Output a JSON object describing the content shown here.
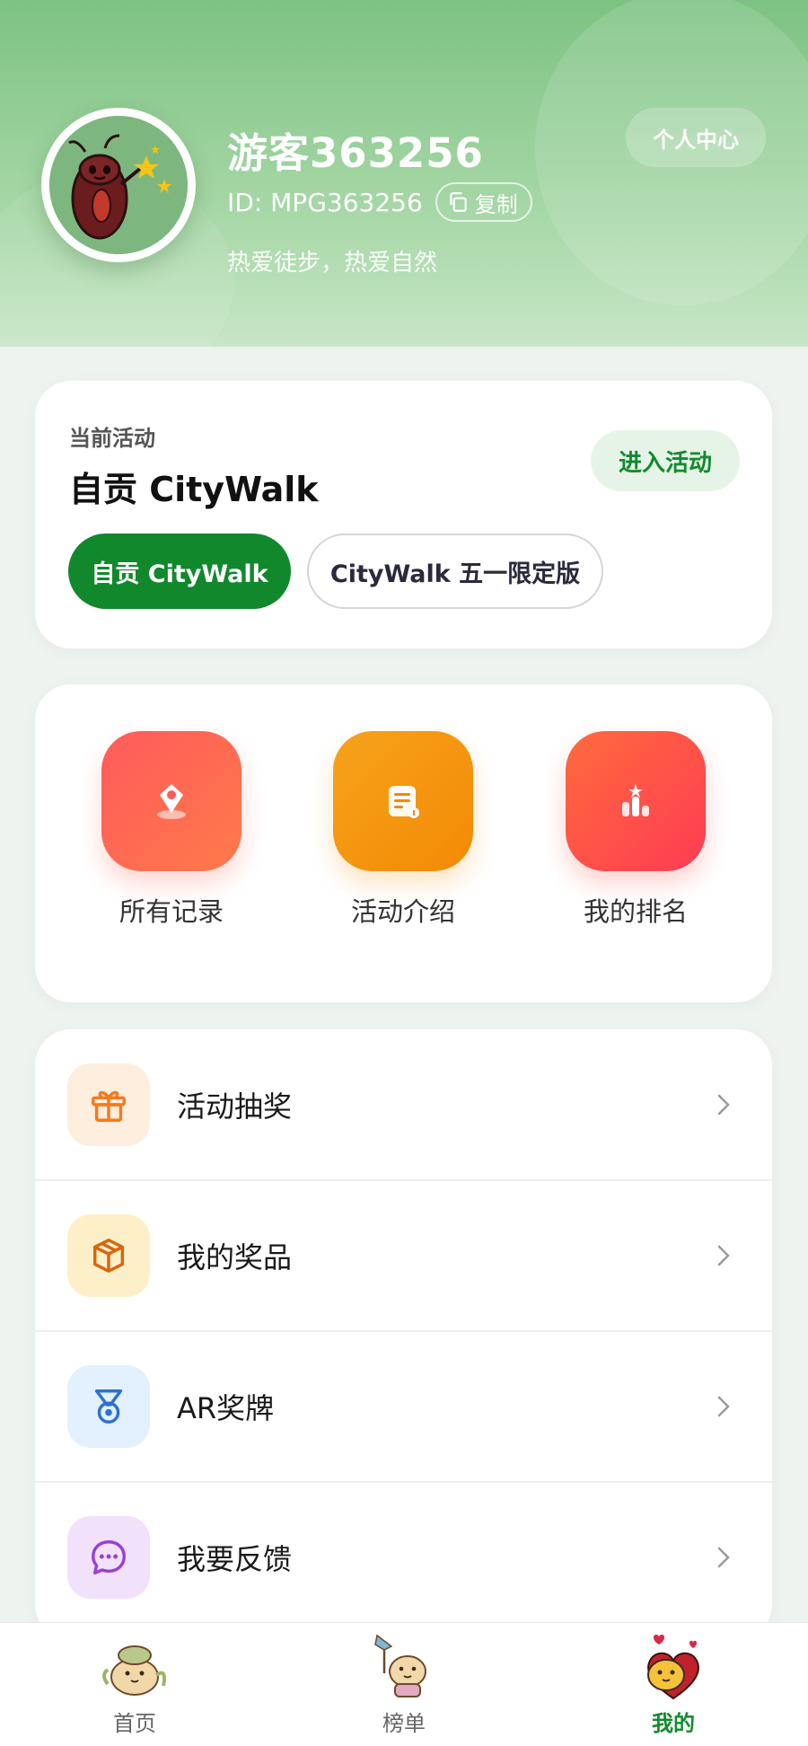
{
  "header": {
    "username": "游客363256",
    "user_id": "ID: MPG363256",
    "copy_label": "复制",
    "bio": "热爱徒步，热爱自然",
    "personal_center_label": "个人中心"
  },
  "activity": {
    "section_label": "当前活动",
    "current_title": "自贡 CityWalk",
    "enter_label": "进入活动",
    "options": [
      {
        "label": "自贡 CityWalk",
        "selected": true
      },
      {
        "label": "CityWalk 五一限定版",
        "selected": false
      }
    ]
  },
  "quick_actions": [
    {
      "label": "所有记录",
      "icon": "location-pin-icon"
    },
    {
      "label": "活动介绍",
      "icon": "document-icon"
    },
    {
      "label": "我的排名",
      "icon": "podium-icon"
    }
  ],
  "menu": [
    {
      "label": "活动抽奖",
      "icon": "gift-icon",
      "color": "#f47a1f"
    },
    {
      "label": "我的奖品",
      "icon": "box-icon",
      "color": "#d9650e"
    },
    {
      "label": "AR奖牌",
      "icon": "medal-icon",
      "color": "#2f6fd6"
    },
    {
      "label": "我要反馈",
      "icon": "chat-icon",
      "color": "#9b3fd8"
    }
  ],
  "tabbar": [
    {
      "label": "首页",
      "icon": "home-mascot-icon",
      "selected": false
    },
    {
      "label": "榜单",
      "icon": "ranking-mascot-icon",
      "selected": false
    },
    {
      "label": "我的",
      "icon": "profile-mascot-icon",
      "selected": true
    }
  ],
  "colors": {
    "brand_green": "#12882d",
    "header_green": "#7dc283",
    "background": "#eef3f0"
  }
}
